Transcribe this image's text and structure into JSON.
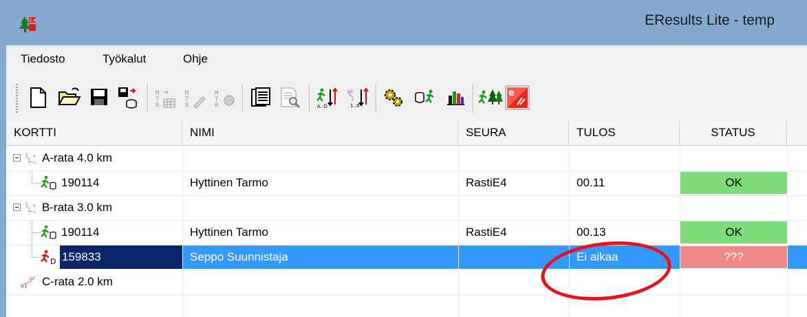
{
  "window": {
    "title": "EResults Lite - temp",
    "app_icon": "eresults-tree-icon"
  },
  "menu": [
    {
      "label": "Tiedosto"
    },
    {
      "label": "Työkalut"
    },
    {
      "label": "Ohje"
    }
  ],
  "toolbar": {
    "buttons": [
      "new-file-icon",
      "open-folder-icon",
      "save-icon",
      "save-export-icon",
      "import-table-icon",
      "edit-entry-icon",
      "timing-icon",
      "results-sheet-icon",
      "print-preview-icon",
      "sort-runners-icon",
      "sort-courses-icon",
      "settings-gears-icon",
      "runner-card-icon",
      "bar-chart-icon",
      "forest-runner-icon",
      "emit-icon"
    ]
  },
  "table": {
    "columns": [
      "KORTTI",
      "NIMI",
      "SEURA",
      "TULOS",
      "STATUS"
    ],
    "rows": [
      {
        "type": "course",
        "kortti": "A-rata 4.0 km"
      },
      {
        "type": "runner",
        "kortti": "190114",
        "nimi": "Hyttinen Tarmo",
        "seura": "RastiE4",
        "tulos": "00.11",
        "status": "OK"
      },
      {
        "type": "course",
        "kortti": "B-rata 3.0 km"
      },
      {
        "type": "runner",
        "kortti": "190114",
        "nimi": "Hyttinen Tarmo",
        "seura": "RastiE4",
        "tulos": "00.13",
        "status": "OK"
      },
      {
        "type": "runner-selected",
        "kortti": "159833",
        "nimi": "Seppo Suunnistaja",
        "seura": "",
        "tulos": "Ei aikaa",
        "status": "???"
      },
      {
        "type": "course",
        "kortti": "C-rata 2.0 km"
      }
    ]
  },
  "colors": {
    "titlebar": "#86a9cf",
    "selection": "#3399ff",
    "status_ok": "#7fdc7a",
    "status_bad": "#f08a8a",
    "annotation": "#e8101a"
  }
}
